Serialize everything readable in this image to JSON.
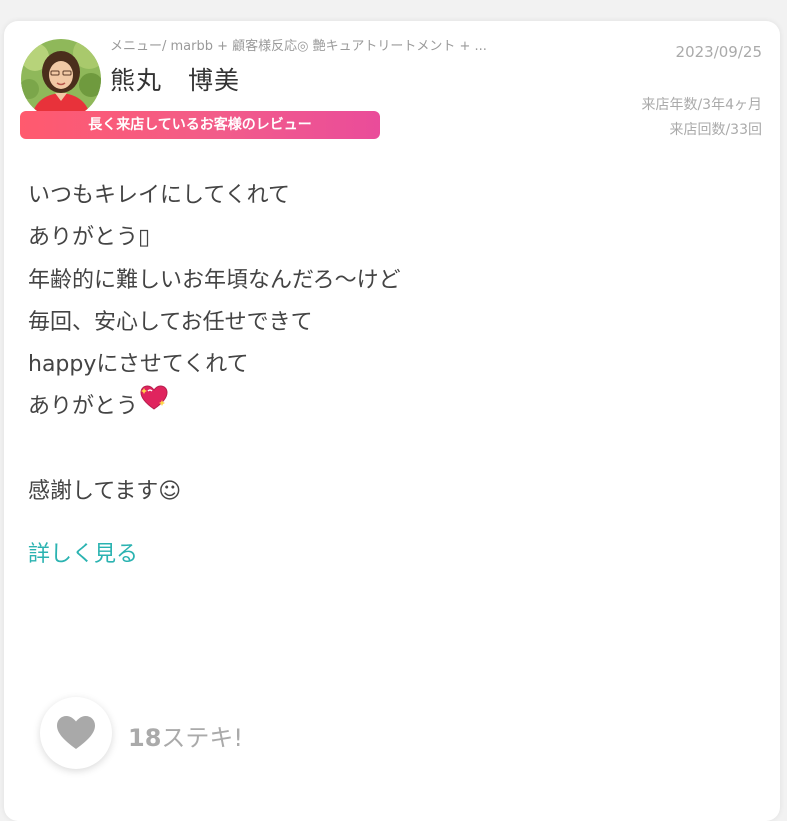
{
  "review": {
    "menu": "メニュー/ marbb + 顧客様反応◎ 艶キュアトリートメント + ...",
    "reviewer_name": "熊丸　博美",
    "badge": "長く来店しているお客様のレビュー",
    "date": "2023/09/25",
    "visit_years": "来店年数/3年4ヶ月",
    "visit_count": "来店回数/33回",
    "lines": [
      "いつもキレイにしてくれて",
      "ありがとう▯",
      "年齢的に難しいお年頃なんだろ〜けど",
      "毎回、安心してお任せできて",
      "happyにさせてくれて",
      "ありがとう",
      "",
      "感謝してます☺"
    ],
    "more_link": "詳しく見る"
  },
  "like": {
    "count": "18",
    "label": "ステキ!",
    "icon": "heart-icon"
  },
  "icons": {
    "sparkle_heart": "sparkling-heart-icon",
    "avatar": "avatar"
  },
  "colors": {
    "badge_start": "#ff5a6e",
    "badge_end": "#ea4c9a",
    "link": "#2bb3b1",
    "heart": "#a9a9a9"
  }
}
